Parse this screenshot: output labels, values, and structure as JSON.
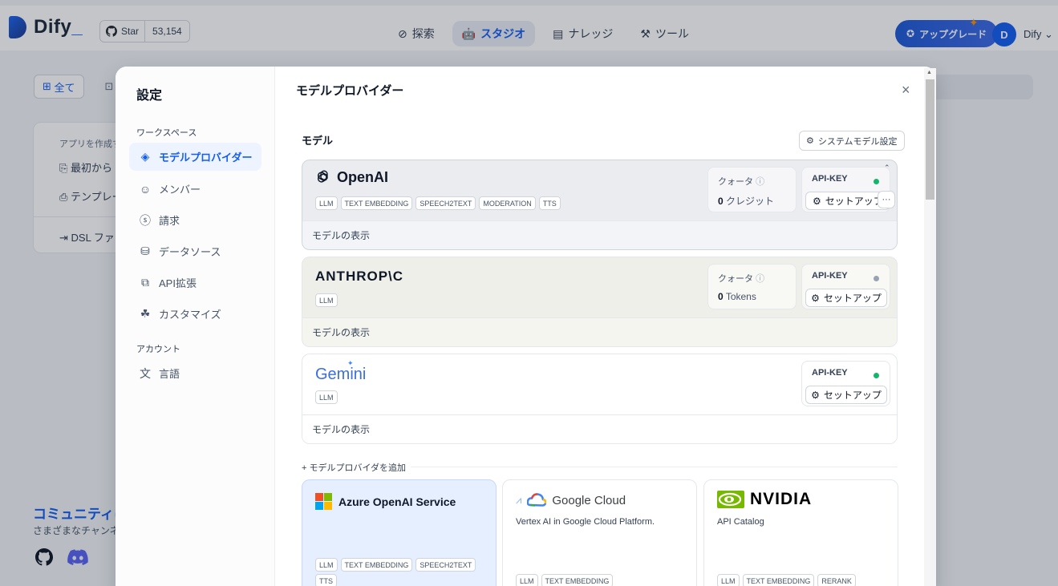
{
  "header": {
    "logo_text": "Dify",
    "github": {
      "star_label": "Star",
      "count": "53,154"
    },
    "nav": [
      {
        "label": "探索"
      },
      {
        "label": "スタジオ"
      },
      {
        "label": "ナレッジ"
      },
      {
        "label": "ツール"
      }
    ],
    "upgrade_label": "アップグレード",
    "user": {
      "initial": "D",
      "name": "Dify"
    }
  },
  "background": {
    "tab_all": "全て",
    "card": {
      "title": "アプリを作成す",
      "item1": "最初から",
      "item2": "テンプレー",
      "item3": "DSL ファ"
    },
    "community_title": "コミュニティに参",
    "community_sub": "さまざまなチャンネル"
  },
  "modal": {
    "sidebar": {
      "title": "設定",
      "workspace_section": "ワークスペース",
      "items": [
        {
          "label": "モデルプロバイダー"
        },
        {
          "label": "メンバー"
        },
        {
          "label": "請求"
        },
        {
          "label": "データソース"
        },
        {
          "label": "API拡張"
        },
        {
          "label": "カスタマイズ"
        }
      ],
      "account_section": "アカウント",
      "account_items": [
        {
          "label": "言語"
        }
      ]
    },
    "main": {
      "title": "モデルプロバイダー",
      "close": "×",
      "models_label": "モデル",
      "system_model_button": "システムモデル設定",
      "providers": [
        {
          "name": "OpenAI",
          "tags": [
            "LLM",
            "TEXT EMBEDDING",
            "SPEECH2TEXT",
            "MODERATION",
            "TTS"
          ],
          "quota_label": "クォータ",
          "quota_value": "0",
          "quota_unit": "クレジット",
          "api_key_label": "API-KEY",
          "setup_label": "セットアップ",
          "more_label": "···",
          "show_models": "モデルの表示",
          "status_color": "#12b76a"
        },
        {
          "name": "ANTHROP\\C",
          "tags": [
            "LLM"
          ],
          "quota_label": "クォータ",
          "quota_value": "0",
          "quota_unit": "Tokens",
          "api_key_label": "API-KEY",
          "setup_label": "セットアップ",
          "show_models": "モデルの表示",
          "status_color": "#98a2b3"
        },
        {
          "name": "Gemini",
          "tags": [
            "LLM"
          ],
          "api_key_label": "API-KEY",
          "setup_label": "セットアップ",
          "show_models": "モデルの表示",
          "status_color": "#12b76a"
        }
      ],
      "add_provider_label": "+ モデルプロバイダを追加",
      "available": [
        {
          "name": "Azure OpenAI Service",
          "tags": [
            "LLM",
            "TEXT EMBEDDING",
            "SPEECH2TEXT",
            "TTS"
          ]
        },
        {
          "name": "Google Cloud",
          "description": "Vertex AI in Google Cloud Platform.",
          "tags": [
            "LLM",
            "TEXT EMBEDDING"
          ]
        },
        {
          "name": "NVIDIA",
          "description": "API Catalog",
          "tags": [
            "LLM",
            "TEXT EMBEDDING",
            "RERANK"
          ]
        }
      ]
    }
  }
}
